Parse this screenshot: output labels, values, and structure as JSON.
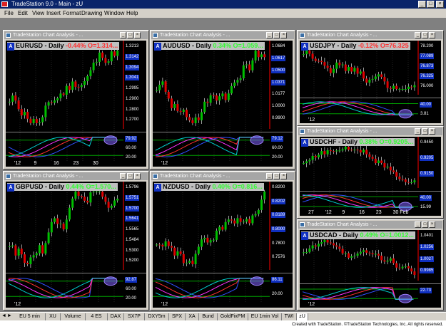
{
  "app": {
    "title": "TradeStation 9.0 - Main - zU"
  },
  "menu": [
    "File",
    "Edit",
    "View",
    "Insert",
    "Format",
    "Drawing",
    "Window",
    "Help"
  ],
  "window_caption": "TradeStation Chart Analysis - ...",
  "charts": [
    {
      "id": "eurusd",
      "symbol": "EURUSD - Daily",
      "change": "-0.44%",
      "open": "O=1.314...",
      "change_color": "#ff3030",
      "prices": [
        "1.3213",
        "1.3142",
        "1.3094",
        "1.3041",
        "1.2995",
        "1.2900",
        "1.2800",
        "1.2700"
      ],
      "ind": [
        "79.92",
        "60.00",
        "20.00"
      ],
      "dates": [
        "'12",
        "9",
        "16",
        "23",
        "30"
      ],
      "trend": "up"
    },
    {
      "id": "audusd",
      "symbol": "AUDUSD - Daily",
      "change": "0.34%",
      "open": "O=1.059...",
      "change_color": "#30ff30",
      "prices": [
        "1.0684",
        "1.0617",
        "1.0500",
        "1.0371",
        "1.0177",
        "1.0000",
        "0.9900"
      ],
      "ind": [
        "79.12",
        "60.00",
        "20.00"
      ],
      "dates": [
        "'12"
      ],
      "trend": "up"
    },
    {
      "id": "usdjpy",
      "symbol": "USDJPY - Daily",
      "change": "-0.12%",
      "open": "O=76.325",
      "change_color": "#ff3030",
      "prices": [
        "78.200",
        "77.089",
        "76.873",
        "76.325",
        "76.000"
      ],
      "ind": [
        "40.00",
        "3.81"
      ],
      "dates": [
        "'12"
      ],
      "trend": "down"
    },
    {
      "id": "usdchf",
      "symbol": "USDCHF - Daily",
      "change": "0.38%",
      "open": "O=0.9205...",
      "change_color": "#30ff30",
      "prices": [
        "0.9450",
        "0.9205",
        "0.9150"
      ],
      "ind": [
        "40.00",
        "15.99"
      ],
      "dates": [
        "27",
        "'12",
        "9",
        "16",
        "23",
        "30 Feb"
      ],
      "trend": "down"
    },
    {
      "id": "gbpusd",
      "symbol": "GBPUSD - Daily",
      "change": "0.44%",
      "open": "O=1.570...",
      "change_color": "#30ff30",
      "prices": [
        "1.5796",
        "1.5751",
        "1.5700",
        "1.5641",
        "1.5565",
        "1.5484",
        "1.5300",
        "1.5200"
      ],
      "ind": [
        "92.87",
        "60.00",
        "20.00"
      ],
      "dates": [
        "'12"
      ],
      "trend": "up"
    },
    {
      "id": "nzdusd",
      "symbol": "NZDUSD - Daily",
      "change": "0.40%",
      "open": "O=0.816...",
      "change_color": "#30ff30",
      "prices": [
        "0.8200",
        "0.8202",
        "0.8189",
        "0.8000",
        "0.7800",
        "0.7576"
      ],
      "ind": [
        "86.11",
        "20.00"
      ],
      "dates": [
        "'12"
      ],
      "trend": "up"
    },
    {
      "id": "usdcad",
      "symbol": "USDCAD - Daily",
      "change": "0.49%",
      "open": "O=1.0012...",
      "change_color": "#30ff30",
      "prices": [
        "1.0401",
        "1.0256",
        "1.0027",
        "0.9985"
      ],
      "ind": [
        "22.73"
      ],
      "dates": [
        "'12"
      ],
      "trend": "down"
    }
  ],
  "tabs": [
    "EU 5 min",
    "XU",
    "Volume",
    "4 ES",
    "DAX",
    "SX7P",
    "DXY5m",
    "SPX",
    "XA",
    "Bund",
    "GoldFixPM",
    "EU 1min Vol",
    "TWI",
    "zU"
  ],
  "status": "Created with TradeStation. ©TradeStation Technologies, Inc. All rights reserved.",
  "colors": {
    "up": "#00c000",
    "down": "#e00000",
    "price_line": "#ff0000"
  }
}
